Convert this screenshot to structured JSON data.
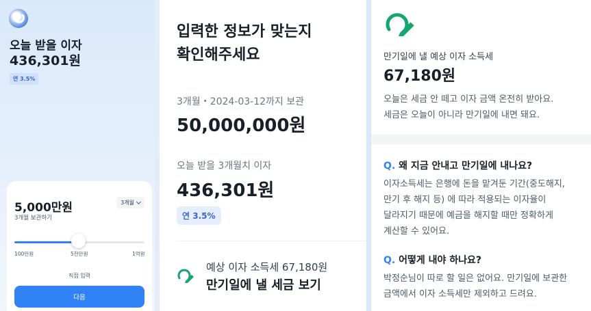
{
  "left_panel": {
    "interest_label": "오늘 받을 이자",
    "interest_amount": "436,301원",
    "rate_badge": "연 3.5%",
    "card": {
      "amount": "5,000만원",
      "subtitle": "3개월 보관하기",
      "period_select": "3개월",
      "slider": {
        "min_label": "100만원",
        "mid_label": "5천만원",
        "max_label": "1억원",
        "value_fraction": 0.49
      },
      "direct_input_label": "직접 입력",
      "next_button": "다음"
    }
  },
  "middle_panel": {
    "title_line1": "입력한 정보가 맞는지",
    "title_line2": "확인해주세요",
    "period_text": "3개월・2024-03-12까지 보관",
    "principal": "50,000,000원",
    "interest_label": "오늘 받을 3개월치 이자",
    "interest_amount": "436,301원",
    "rate_badge": "연 3.5%",
    "tax_line": "예상 이자 소득세 67,180원",
    "tax_title": "만기일에 낼 세금 보기"
  },
  "right_panel": {
    "tax_label": "만기일에 낼 예상 이자 소득세",
    "tax_amount": "67,180원",
    "desc_line1": "오늘은 세금 안 떼고 이자 금액 온전히 받아요.",
    "desc_line2": "세금은 오늘이 아니라 만기일에 내면 돼요.",
    "faq": [
      {
        "q_mark": "Q.",
        "question": "왜 지금 안내고 만기일에 내나요?",
        "answer_lines": [
          "이자소득세는 은행에 돈을 맡겨둔 기간(중도해지,",
          "만기 후 해지 등) 에 따라 적용되는 이자율이",
          "달라지기 때문에 예금을 해지할 때만 정확하게",
          "계산할 수 있어요."
        ]
      },
      {
        "q_mark": "Q.",
        "question": "어떻게 내야 하나요?",
        "answer_lines": [
          "박정순님이 따로 할 일은 없어요. 만기일에 보관한",
          "금액에서 이자 소득세만 제외하고 드려요."
        ]
      }
    ]
  },
  "colors": {
    "accent": "#3182f6",
    "icon_green": "#15a56e",
    "text": "#191f28",
    "muted": "#4e5968"
  },
  "icons": {
    "logo": "app-logo",
    "tax": "percent-pencil-icon"
  }
}
